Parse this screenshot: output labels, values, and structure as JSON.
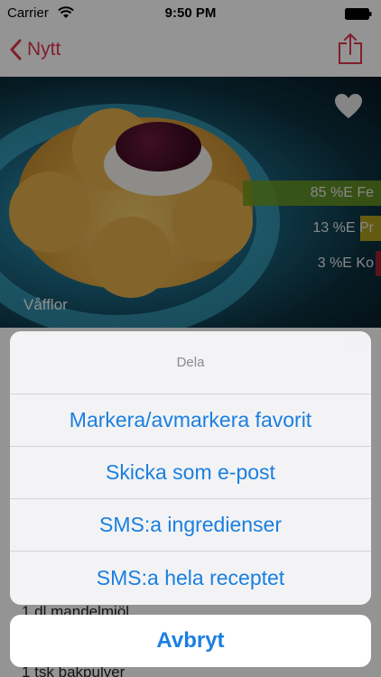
{
  "status_bar": {
    "carrier": "Carrier",
    "time": "9:50 PM"
  },
  "nav": {
    "back_label": "Nytt",
    "accent_color": "#e0344d"
  },
  "recipe": {
    "title": "Våfflor",
    "nutrients": [
      {
        "label": "85 %E Fe",
        "color": "#6d9a1f",
        "fill_percent": 85
      },
      {
        "label": "13 %E Pr",
        "color": "#c9b21a",
        "fill_percent": 13
      },
      {
        "label": "3 %E Ko",
        "color": "#b3202c",
        "fill_percent": 3
      }
    ],
    "overlay_fragment": "flor",
    "ingredients": [
      "1 dl mandelmjöl",
      "1 tsk bakpulver"
    ]
  },
  "share_sheet": {
    "title": "Dela",
    "items": [
      "Markera/avmarkera favorit",
      "Skicka som e-post",
      "SMS:a ingredienser",
      "SMS:a hela receptet"
    ],
    "cancel_label": "Avbryt",
    "action_color": "#1a7fe0"
  },
  "icons": {
    "wifi": "wifi-icon",
    "battery": "battery-icon",
    "back": "chevron-left-icon",
    "share": "share-icon",
    "favorite": "heart-icon"
  }
}
